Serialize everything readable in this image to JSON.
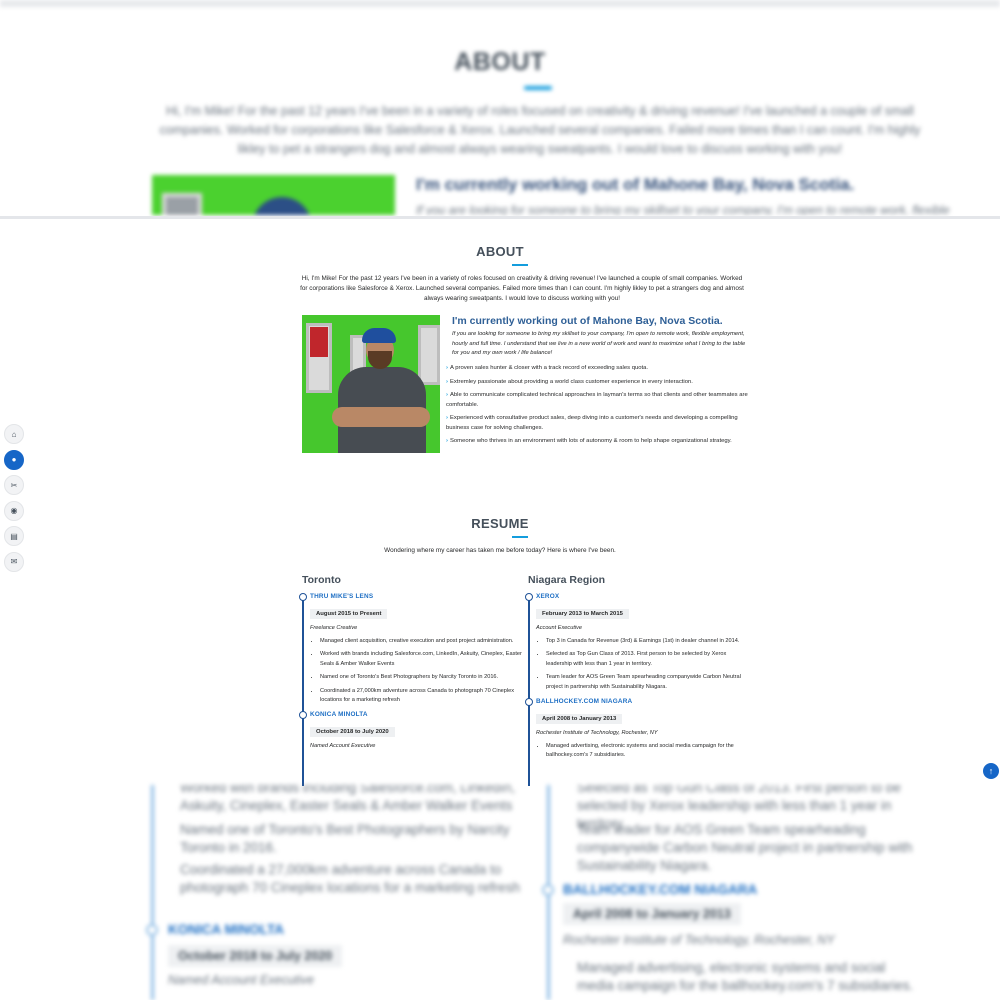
{
  "about": {
    "title": "ABOUT",
    "intro": "Hi, I'm Mike! For the past 12 years I've been in a variety of roles focused on creativity & driving revenue! I've launched a couple of small companies. Worked for corporations like Salesforce & Xerox. Launched several companies. Failed more times than I can count. I'm highly likley to pet a strangers dog and almost always wearing sweatpants. I would love to discuss working with you!",
    "heading": "I'm currently working out of Mahone Bay, Nova Scotia.",
    "subheading": "If you are looking for someone to bring my skillset to your company, I'm open to remote work, flexible employment, hourly and full time. I understand that we live in a new world of work and want to maximize what I bring to the table for you and my own work / life balance!",
    "points": [
      "A proven sales hunter & closer with a track record of exceeding sales quota.",
      "Extremley passionate about providing a world class customer experience in every interaction.",
      "Able to communicate complicated technical approaches in layman's terms so that clients and other teammates are comfortable.",
      "Experienced with consultative product sales, deep diving into a customer's needs and developing a compelling business case for solving challenges.",
      "Someone who thrives in an environment with lots of autonomy & room to help shape organizational strategy."
    ],
    "chevron": "›"
  },
  "resume": {
    "title": "RESUME",
    "intro": "Wondering where my career has taken me before today? Here is where I've been.",
    "columns": [
      {
        "heading": "Toronto",
        "items": [
          {
            "name": "THRU MIKE'S LENS",
            "date": "August 2015 to Present",
            "role": "Freelance Creative",
            "bullets": [
              "Managed client acquisition, creative execution and post project administration.",
              "Worked with brands including Salesforce.com, LinkedIn, Askuity, Cineplex, Easter Seals & Amber Walker Events",
              "Named one of Toronto's Best Photographers by Narcity Toronto in 2016.",
              "Coordinated a 27,000km adventure across Canada to photograph 70 Cineplex locations for a marketing refresh"
            ]
          },
          {
            "name": "KONICA MINOLTA",
            "date": "October 2018 to July 2020",
            "role": "Named Account Executive",
            "bullets": []
          }
        ]
      },
      {
        "heading": "Niagara Region",
        "items": [
          {
            "name": "XEROX",
            "date": "February 2013 to March 2015",
            "role": "Account Executive",
            "bullets": [
              "Top 3 in Canada for Revenue (3rd) & Earnings (1st) in dealer channel in 2014.",
              "Selected as Top Gun Class of 2013. First person to be selected by Xerox leadership with less than 1 year in territory.",
              "Team leader for AOS Green Team spearheading companywide Carbon Neutral project in partnership with Sustainability Niagara."
            ]
          },
          {
            "name": "BALLHOCKEY.COM NIAGARA",
            "date": "April 2008 to January 2013",
            "role": "Rochester Institute of Technology, Rochester, NY",
            "bullets": [
              "Managed advertising, electronic systems and social media campaign for the ballhockey.com's 7 subsidiaries."
            ]
          }
        ]
      }
    ]
  },
  "blurred": {
    "top_title": "ABOUT",
    "top_intro": "Hi, I'm Mike! For the past 12 years I've been in a variety of roles focused on creativity & driving revenue! I've launched a couple of small companies. Worked for corporations like Salesforce & Xerox. Launched several companies. Failed more times than I can count. I'm highly likley to pet a strangers dog and almost always wearing sweatpants. I would love to discuss working with you!",
    "top_heading": "I'm currently working out of Mahone Bay, Nova Scotia.",
    "top_sub": "If you are looking for someone to bring my skillset to your company, I'm open to remote work, flexible",
    "bottom_left_1": "Worked with brands including Salesforce.com, LinkedIn, Askuity, Cineplex, Easter Seals & Amber Walker Events",
    "bottom_left_2": "Named one of Toronto's Best Photographers by Narcity Toronto in 2016.",
    "bottom_left_3": "Coordinated a 27,000km adventure across Canada to photograph 70 Cineplex locations for a marketing refresh",
    "bottom_left_name": "KONICA MINOLTA",
    "bottom_left_date": "October 2018 to July 2020",
    "bottom_left_role": "Named Account Executive",
    "bottom_right_1": "Selected as Top Gun Class of 2013. First person to be selected by Xerox leadership with less than 1 year in territory.",
    "bottom_right_2": "Team leader for AOS Green Team spearheading companywide Carbon Neutral project in partnership with Sustainability Niagara.",
    "bottom_right_name": "BALLHOCKEY.COM NIAGARA",
    "bottom_right_date": "April 2008 to January 2013",
    "bottom_right_role": "Rochester Institute of Technology, Rochester, NY",
    "bottom_right_3": "Managed advertising, electronic systems and social media campaign for the ballhockey.com's 7 subsidiaries."
  },
  "nav": {
    "items": [
      {
        "icon": "home-icon",
        "glyph": "⌂",
        "active": false
      },
      {
        "icon": "user-icon",
        "glyph": "●",
        "active": true
      },
      {
        "icon": "tools-icon",
        "glyph": "✂",
        "active": false
      },
      {
        "icon": "camera-icon",
        "glyph": "◉",
        "active": false
      },
      {
        "icon": "document-icon",
        "glyph": "▤",
        "active": false
      },
      {
        "icon": "mail-icon",
        "glyph": "✉",
        "active": false
      }
    ]
  },
  "back_to_top": {
    "glyph": "↑"
  },
  "colors": {
    "accent": "#149ddd",
    "link_blue": "#1e6fc4",
    "nav_active": "#1666c7",
    "heading": "#45505b"
  }
}
